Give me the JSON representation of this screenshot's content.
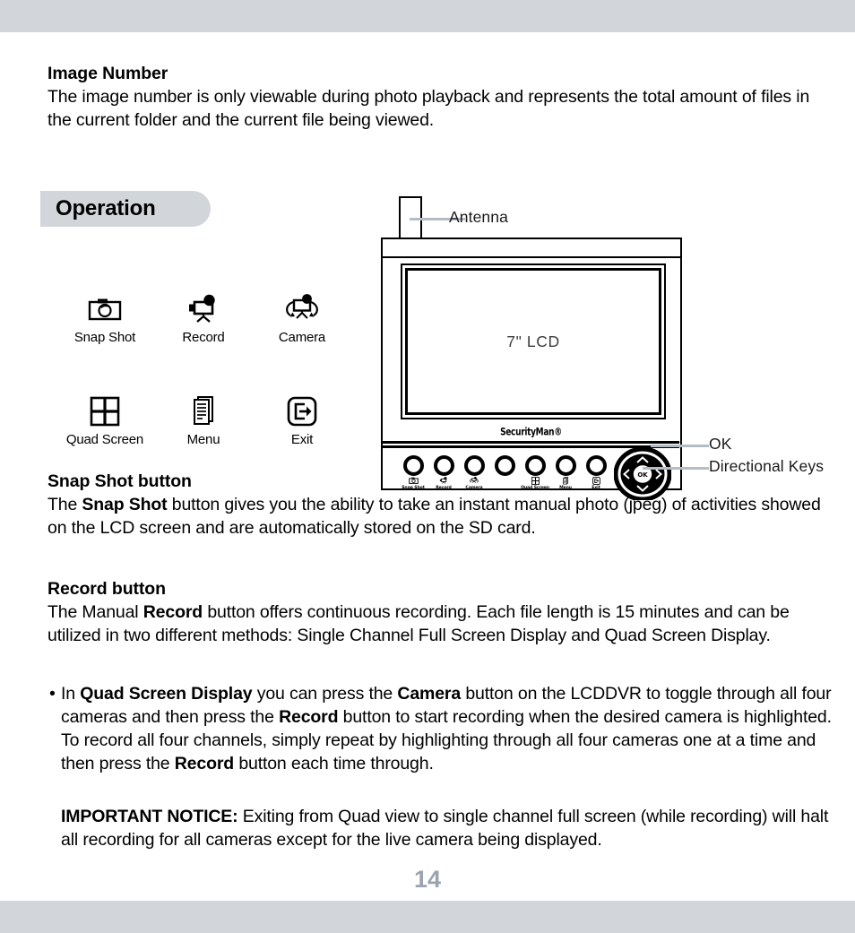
{
  "colors": {
    "band": "#d2d5da",
    "pill": "#d2d5da",
    "callout_line": "#b4bcc6",
    "page_number": "#9aa4b0"
  },
  "intro": {
    "heading": "Image Number",
    "paragraph": "The image number is only viewable during photo playback and represents the total amount of files in the current folder and the current file being viewed."
  },
  "operation": {
    "pill_label": "Operation"
  },
  "icon_legend": {
    "items": [
      {
        "icon": "snap-shot-icon",
        "label": "Snap Shot"
      },
      {
        "icon": "record-icon",
        "label": "Record"
      },
      {
        "icon": "camera-icon",
        "label": "Camera"
      },
      {
        "icon": "quad-screen-icon",
        "label": "Quad Screen"
      },
      {
        "icon": "menu-icon",
        "label": "Menu"
      },
      {
        "icon": "exit-icon",
        "label": "Exit"
      }
    ]
  },
  "device": {
    "screen_label": "7\" LCD",
    "brand": "SecurityMan®",
    "antenna_name": "antenna",
    "callouts": [
      {
        "label": "Antenna",
        "name": "callout-antenna"
      },
      {
        "label": "OK",
        "name": "callout-ok"
      },
      {
        "label": "Directional Keys",
        "name": "callout-directional-keys"
      }
    ],
    "dpad": {
      "center_label": "OK",
      "keys": [
        "up",
        "down",
        "left",
        "right"
      ]
    },
    "panel_buttons": [
      {
        "label": "Snap Shot",
        "icon": "snap-shot-icon"
      },
      {
        "label": "Record",
        "icon": "record-icon"
      },
      {
        "label": "Camera",
        "icon": "camera-icon"
      },
      {
        "label": "",
        "icon": ""
      },
      {
        "label": "Quad Screen",
        "icon": "quad-screen-icon"
      },
      {
        "label": "Menu",
        "icon": "menu-icon"
      },
      {
        "label": "Exit",
        "icon": "exit-icon"
      }
    ]
  },
  "snapshot_section": {
    "heading": "Snap Shot button",
    "text_1": "The ",
    "bold_1": "Snap Shot",
    "text_2": " button gives you the ability to take an instant manual photo (jpeg) of activities showed on the LCD screen and are automatically stored on the SD card."
  },
  "record_section": {
    "heading": "Record button",
    "text_1": "The Manual ",
    "bold_1": "Record",
    "text_2": " button offers continuous recording.  Each file length is 15 minutes and can be utilized in two different methods: Single Channel Full Screen Display and Quad Screen Display."
  },
  "bullet_section": {
    "marker": "•",
    "text_1": "In ",
    "bold_1": "Quad Screen Display",
    "text_2": " you can press the ",
    "bold_2": "Camera",
    "text_3": " button on the LCDDVR to toggle through all four cameras and then press the ",
    "bold_3": "Record",
    "text_4": " button to start recording when the desired camera is highlighted. To record all four channels, simply repeat by highlighting through all four cameras one at a time and then press the ",
    "bold_4": "Record",
    "text_5": " button each time through."
  },
  "notice_section": {
    "bold_1": "IMPORTANT NOTICE:",
    "text_1": " Exiting from Quad view to single channel full screen (while recording) will halt all recording for all cameras except for the live camera being displayed."
  },
  "page_number": "14"
}
